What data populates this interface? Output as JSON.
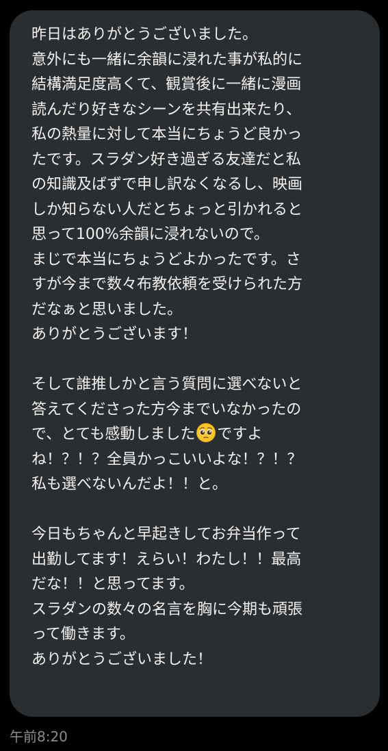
{
  "message": {
    "lines": [
      {
        "text": "昨日はありがとうございました。"
      },
      {
        "text": "意外にも一緒に余韻に浸れた事が私的に"
      },
      {
        "text": "結構満足度高くて、観賞後に一緒に漫画"
      },
      {
        "text": "読んだり好きなシーンを共有出来たり、"
      },
      {
        "text": "私の熱量に対して本当にちょうど良かっ"
      },
      {
        "text": "たです。スラダン好き過ぎる友達だと私"
      },
      {
        "text": "の知識及ばずで申し訳なくなるし、映画"
      },
      {
        "text": "しか知らない人だとちょっと引かれると"
      },
      {
        "text": "思って100%余韻に浸れないので。"
      },
      {
        "text": "まじで本当にちょうどよかったです。さ"
      },
      {
        "text": "すが今まで数々布教依頼を受けられた方"
      },
      {
        "text": "だなぁと思いました。"
      },
      {
        "text": "ありがとうございます！"
      },
      {
        "text": ""
      },
      {
        "text": "そして誰推しかと言う質問に選べないと"
      },
      {
        "text": "答えてくださった方今までいなかったの"
      },
      {
        "before": "で、とても感動しました",
        "emoji": "pleading-face-emoji",
        "after": "ですよ"
      },
      {
        "text": "ね！？！？全員かっこいいよな！？！？"
      },
      {
        "text": "私も選べないんだよ！！と。"
      },
      {
        "text": ""
      },
      {
        "text": "今日もちゃんと早起きしてお弁当作って"
      },
      {
        "text": "出勤してます！えらい！わたし！！最高"
      },
      {
        "text": "だな！！と思ってます。"
      },
      {
        "text": "スラダンの数々の名言を胸に今期も頑張"
      },
      {
        "text": "って働きます。"
      },
      {
        "text": "ありがとうございました！"
      }
    ],
    "timestamp": "午前8:20"
  },
  "colors": {
    "background": "#000000",
    "bubble": "#2b2e31",
    "text": "#f2f2f2",
    "timestamp": "#8a8d90",
    "emoji_face": "#f7c52b"
  }
}
